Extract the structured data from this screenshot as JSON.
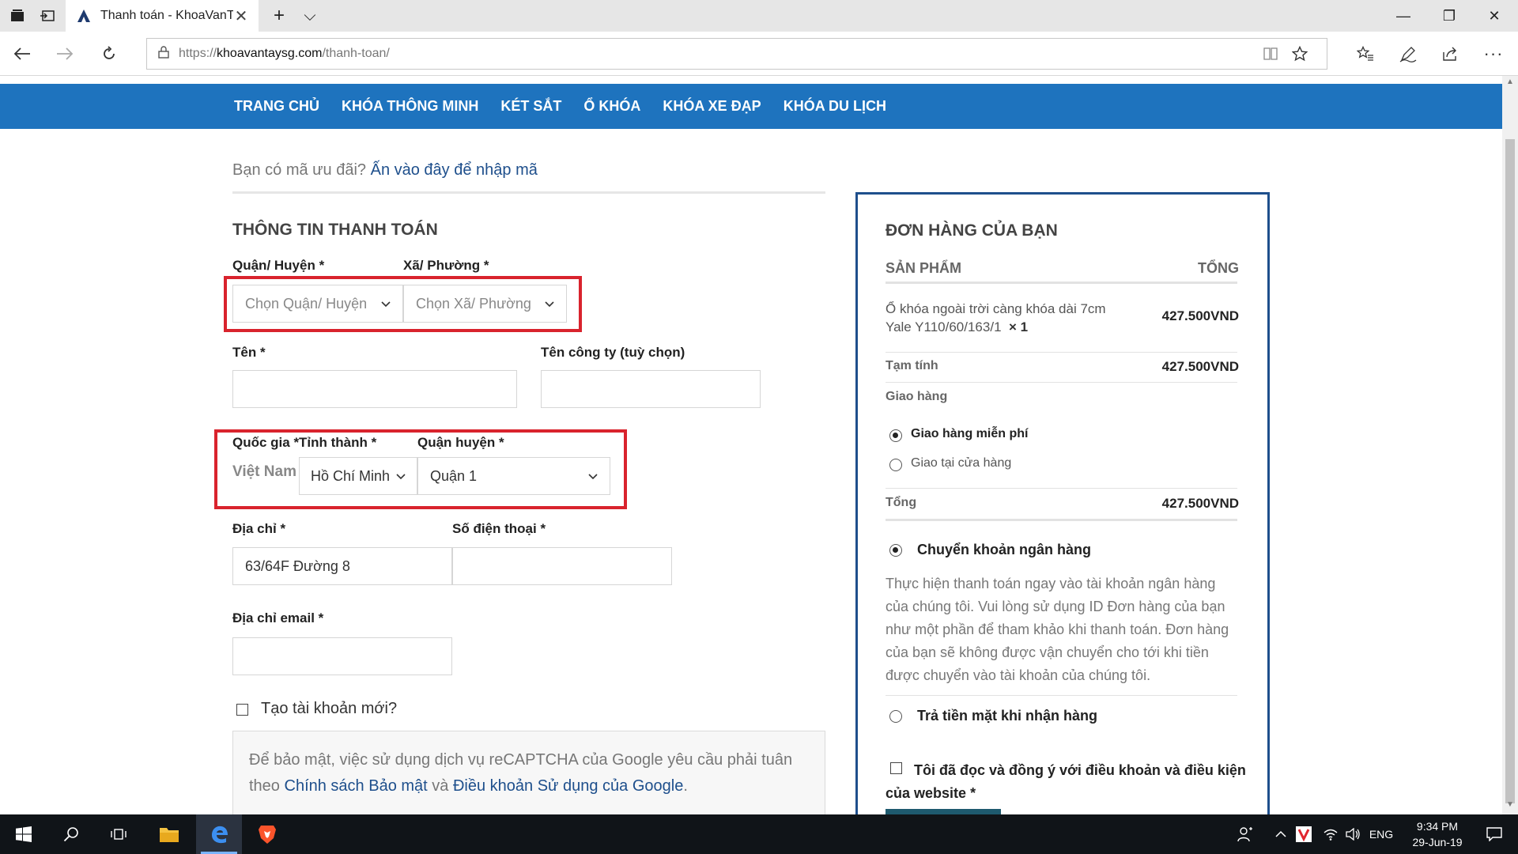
{
  "browser": {
    "tab_title": "Thanh toán - KhoaVanTá",
    "tab_close": "✕",
    "new_tab": "+",
    "tab_list": "⌵",
    "url_scheme": "https://",
    "url_host": "khoavantaysg.com",
    "url_path": "/thanh-toan/",
    "win_min": "—",
    "win_max": "❐",
    "win_close": "✕",
    "icons": [
      "tab-set-aside-icon",
      "tab-preview-icon",
      "back-icon",
      "forward-icon",
      "refresh-icon",
      "lock-icon",
      "reading-view-icon",
      "favorite-star-icon",
      "favorites-hub-icon",
      "pen-icon",
      "share-icon",
      "more-icon"
    ]
  },
  "site": {
    "nav": [
      "TRANG CHỦ",
      "KHÓA THÔNG MINH",
      "KÉT SẮT",
      "Ổ KHÓA",
      "KHÓA XE ĐẠP",
      "KHÓA DU LỊCH"
    ],
    "nav_color": "#1e73be",
    "coupon_text": "Bạn có mã ưu đãi?",
    "coupon_link": "Ấn vào đây để nhập mã"
  },
  "billing": {
    "title": "THÔNG TIN THANH TOÁN",
    "district_label": "Quận/ Huyện",
    "ward_label": "Xã/ Phường",
    "district_placeholder": "Chọn Quận/ Huyện",
    "ward_placeholder": "Chọn Xã/ Phường",
    "first_name_label": "Tên",
    "company_label": "Tên công ty (tuỳ chọn)",
    "country_label": "Quốc gia",
    "province_label": "Tỉnh thành",
    "district2_label": "Quận huyện",
    "country_value": "Việt Nam",
    "province_value": "Hồ Chí Minh",
    "district2_value": "Quận 1",
    "address_label": "Địa chỉ",
    "phone_label": "Số điện thoại",
    "address_value": "63/64F Đường 8",
    "email_label": "Địa chỉ email",
    "create_account_label": "Tạo tài khoản mới?",
    "required_mark": "*",
    "highlight_color": "#d9232d"
  },
  "notice": {
    "text1": "Để bảo mật, việc sử dụng dịch vụ reCAPTCHA của Google yêu cầu phải tuân theo",
    "link1": "Chính sách Bảo mật",
    "and": "và",
    "link2": "Điều khoản Sử dụng của Google",
    "end": "."
  },
  "order": {
    "title": "ĐƠN HÀNG CỦA BẠN",
    "col_product": "SẢN PHẨM",
    "col_total": "TỔNG",
    "item_line1": "Ổ khóa ngoài trời càng khóa dài 7cm",
    "item_line2": "Yale Y110/60/163/1",
    "item_qty": "× 1",
    "item_price": "427.500VND",
    "subtotal_label": "Tạm tính",
    "subtotal_value": "427.500VND",
    "shipping_label": "Giao hàng",
    "ship_free": "Giao hàng miễn phí",
    "ship_store": "Giao tại cửa hàng",
    "total_label": "Tổng",
    "total_value": "427.500VND",
    "pay_bank": "Chuyển khoản ngân hàng",
    "bank_desc": [
      "Thực hiện thanh toán ngay vào tài khoản ngân hàng",
      "của chúng tôi. Vui lòng sử dụng ID Đơn hàng của bạn",
      "như một phần để tham khảo khi thanh toán. Đơn hàng",
      "của bạn sẽ không được vận chuyển cho tới khi tiền",
      "được chuyển vào tài khoản của chúng tôi."
    ],
    "pay_cod": "Trả tiền mặt khi nhận hàng",
    "terms_line1": "Tôi đã đọc và đồng ý với điều khoản và điều kiện",
    "terms_line2": "của website",
    "border_color": "#1e4f8c"
  },
  "taskbar": {
    "lang": "ENG",
    "time": "9:34 PM",
    "date": "29-Jun-19",
    "icons": [
      "windows-start-icon",
      "search-icon",
      "task-view-icon",
      "file-explorer-icon",
      "edge-icon",
      "brave-icon",
      "people-icon",
      "tray-chevron-icon",
      "vivaldi-tray-icon",
      "wifi-icon",
      "volume-icon",
      "notification-icon"
    ]
  }
}
